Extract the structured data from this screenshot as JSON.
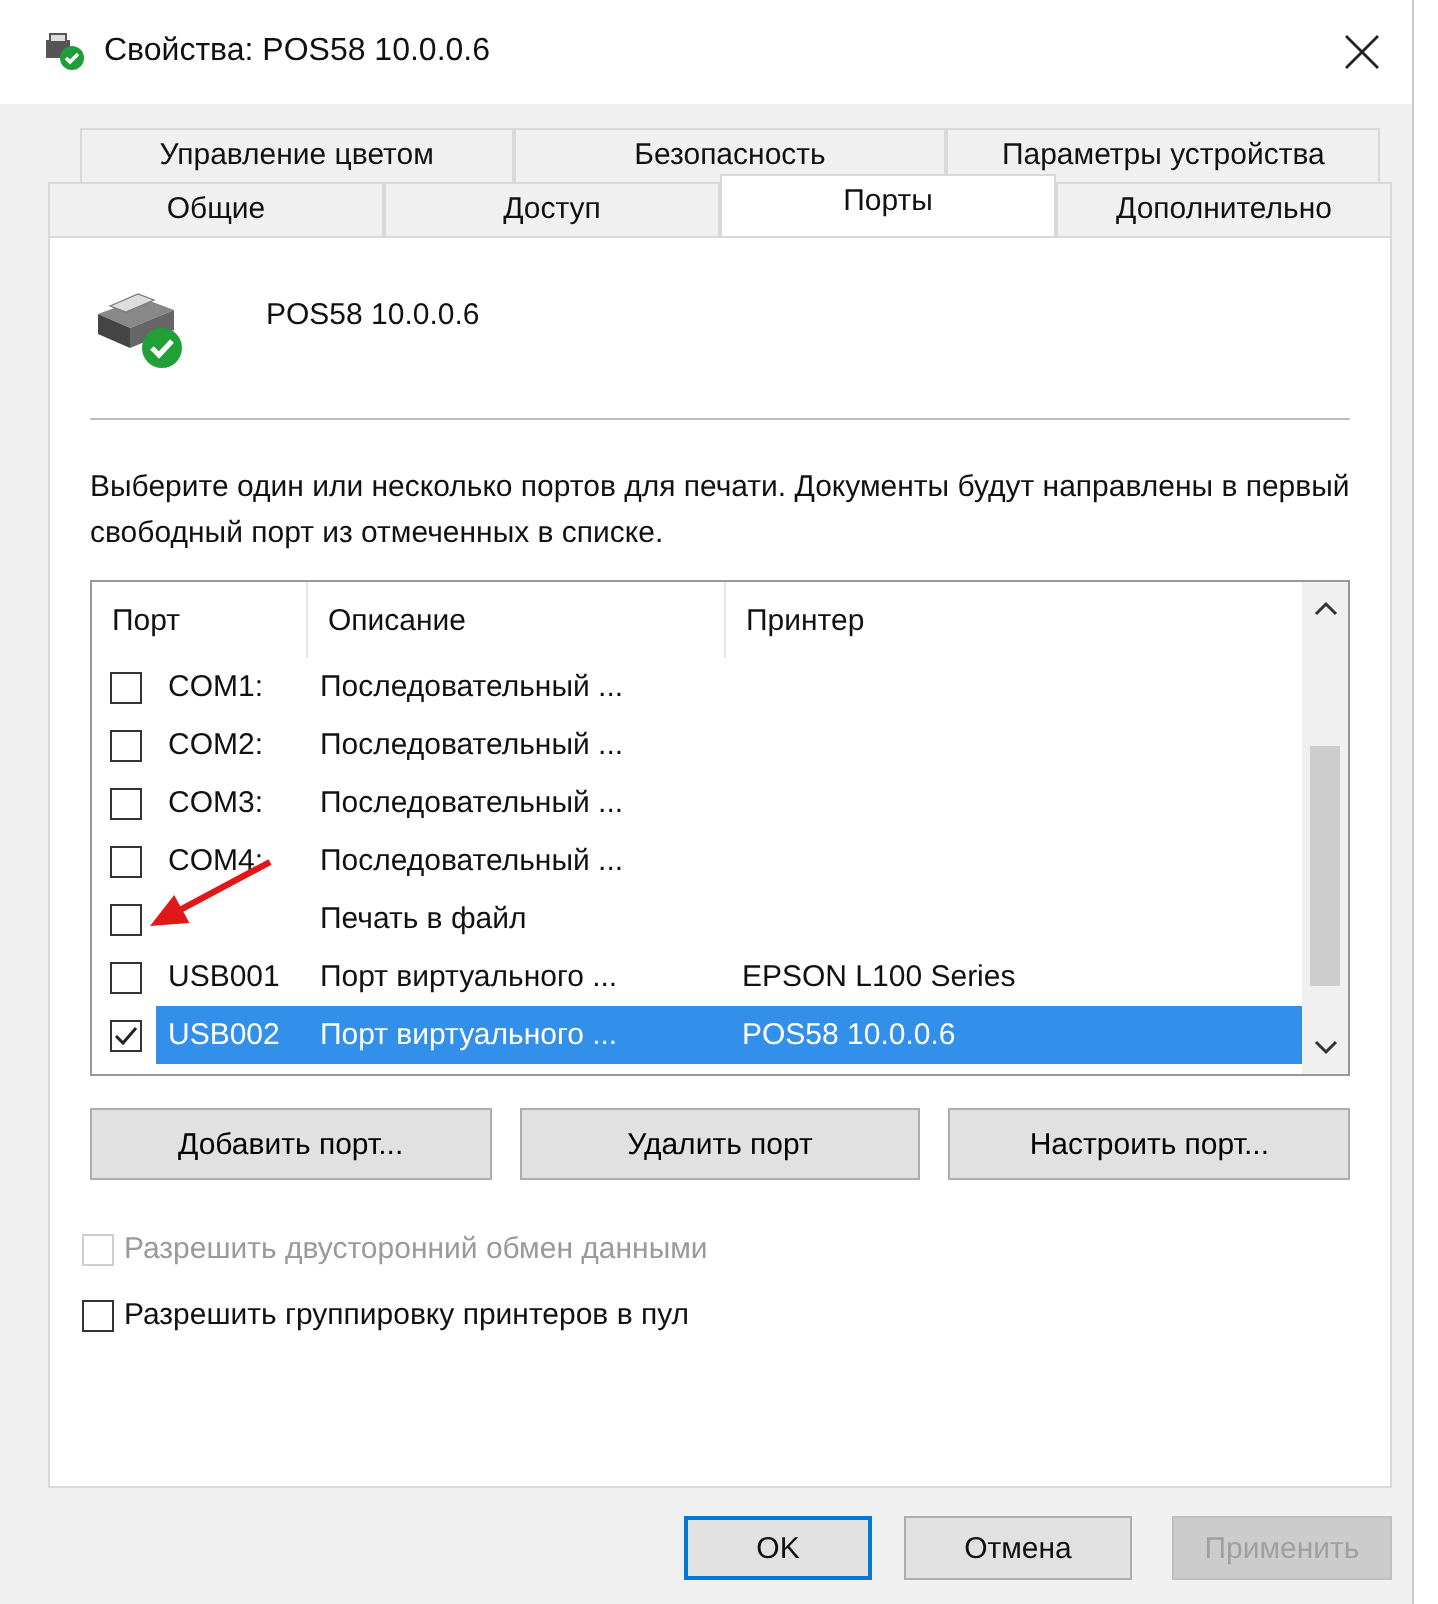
{
  "window": {
    "title": "Свойства: POS58 10.0.0.6"
  },
  "tab_rows": [
    {
      "tabs": [
        {
          "label": "Управление цветом",
          "selected": false
        },
        {
          "label": "Безопасность",
          "selected": false
        },
        {
          "label": "Параметры устройства",
          "selected": false
        }
      ]
    },
    {
      "tabs": [
        {
          "label": "Общие",
          "selected": false
        },
        {
          "label": "Доступ",
          "selected": false
        },
        {
          "label": "Порты",
          "selected": true
        },
        {
          "label": "Дополнительно",
          "selected": false
        }
      ]
    }
  ],
  "printer_name": "POS58 10.0.0.6",
  "instruction": "Выберите один или несколько портов для печати. Документы будут направлены в первый свободный порт из отмеченных в списке.",
  "table": {
    "columns": [
      "Порт",
      "Описание",
      "Принтер"
    ],
    "rows": [
      {
        "checked": false,
        "selected": false,
        "port": "COM1:",
        "description": "Последовательный ..."
      },
      {
        "checked": false,
        "selected": false,
        "port": "COM2:",
        "description": "Последовательный ..."
      },
      {
        "checked": false,
        "selected": false,
        "port": "COM3:",
        "description": "Последовательный ..."
      },
      {
        "checked": false,
        "selected": false,
        "port": "COM4:",
        "description": "Последовательный ..."
      },
      {
        "checked": false,
        "selected": false,
        "description": "Печать в файл"
      },
      {
        "checked": false,
        "selected": false,
        "port": "USB001",
        "description": "Порт виртуального ...",
        "printer": "EPSON L100 Series"
      },
      {
        "checked": true,
        "selected": true,
        "port": "USB002",
        "description": "Порт виртуального ...",
        "printer": "POS58 10.0.0.6"
      }
    ]
  },
  "port_buttons": [
    "Добавить порт...",
    "Удалить порт",
    "Настроить порт..."
  ],
  "options": [
    {
      "label": "Разрешить двусторонний обмен данными",
      "checked": false,
      "disabled": true
    },
    {
      "label": "Разрешить группировку принтеров в пул",
      "checked": false,
      "disabled": false
    }
  ],
  "footer_buttons": [
    {
      "label": "OK",
      "default": true,
      "disabled": false
    },
    {
      "label": "Отмена",
      "default": false,
      "disabled": false
    },
    {
      "label": "Применить",
      "default": false,
      "disabled": true
    }
  ]
}
